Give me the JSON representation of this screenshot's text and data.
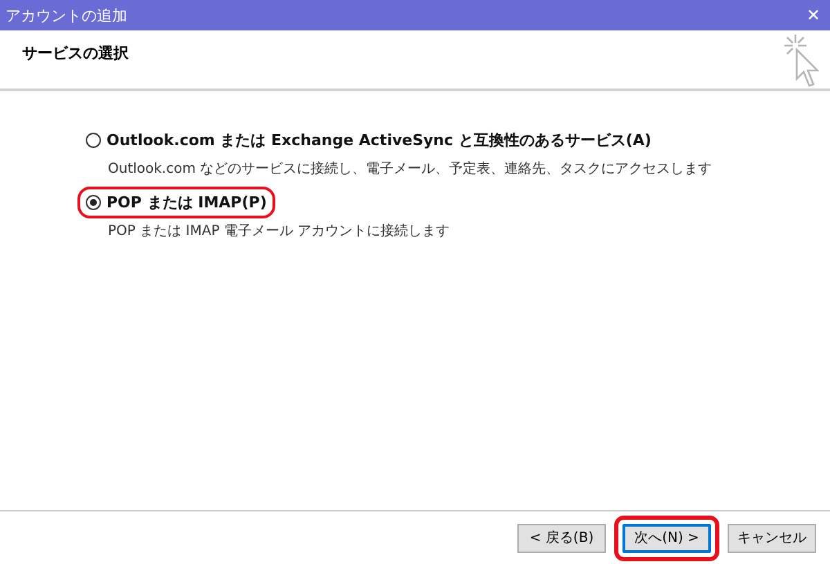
{
  "window": {
    "title": "アカウントの追加",
    "close": "✕"
  },
  "header": {
    "title": "サービスの選択"
  },
  "options": [
    {
      "label": "Outlook.com または Exchange ActiveSync と互換性のあるサービス(A)",
      "description": "Outlook.com などのサービスに接続し、電子メール、予定表、連絡先、タスクにアクセスします",
      "selected": false,
      "highlighted": false
    },
    {
      "label": "POP または IMAP(P)",
      "description": "POP または IMAP 電子メール アカウントに接続します",
      "selected": true,
      "highlighted": true
    }
  ],
  "buttons": [
    {
      "label": "< 戻る(B)",
      "default": false,
      "highlighted": false
    },
    {
      "label": "次へ(N) >",
      "default": true,
      "highlighted": true
    },
    {
      "label": "キャンセル",
      "default": false,
      "highlighted": false
    }
  ]
}
